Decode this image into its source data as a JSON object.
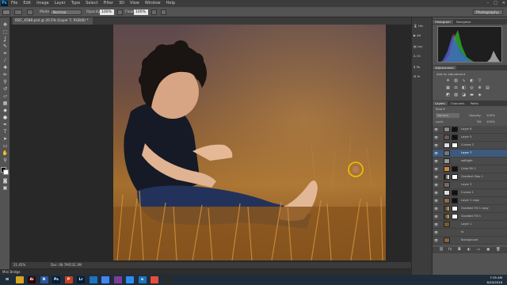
{
  "app": {
    "logo": "Ps"
  },
  "menu": [
    "File",
    "Edit",
    "Image",
    "Layer",
    "Type",
    "Select",
    "Filter",
    "3D",
    "View",
    "Window",
    "Help"
  ],
  "window_controls": [
    "–",
    "□",
    "✕"
  ],
  "options": {
    "mode_label": "Mode:",
    "mode_value": "Normal",
    "opacity_label": "Opacity:",
    "opacity_value": "100%",
    "flow_label": "Flow:",
    "flow_value": "100%",
    "workspace": "Photography"
  },
  "document": {
    "tab_title": "DSC_4588.psd @ 20.5% (Layer 7, RGB/8) *",
    "zoom": "21.45%",
    "doc_info": "Doc: 68.7M/532.3M"
  },
  "minibridge": "Mini Bridge",
  "dock_labels": [
    "His",
    "Ad",
    "Lay",
    "Ch",
    "Pa",
    "Pr"
  ],
  "panels": {
    "histogram_tabs": [
      "Histogram",
      "Navigator"
    ],
    "adjustments_tab": "Adjustments",
    "adjustments_hint": "Add an adjustment",
    "layers_tabs": [
      "Layers",
      "Channels",
      "Paths"
    ],
    "kind_label": "Kind",
    "blend_mode": "Normal",
    "opacity_label": "Opacity:",
    "opacity_value": "100%",
    "lock_label": "Lock:",
    "fill_label": "Fill:",
    "fill_value": "100%"
  },
  "layers": [
    {
      "name": "Layer 6"
    },
    {
      "name": "Layer 5"
    },
    {
      "name": "Curves 2"
    },
    {
      "name": "Layer 7"
    },
    {
      "name": "softlight"
    },
    {
      "name": "Color Fill 1"
    },
    {
      "name": "Gradient Map 1"
    },
    {
      "name": "Layer 3"
    },
    {
      "name": "Curves 1"
    },
    {
      "name": "Layer 2 copy"
    },
    {
      "name": "Gradient Fill 1 copy"
    },
    {
      "name": "Gradient Fill 1"
    },
    {
      "name": "Layer 1"
    },
    {
      "name": "fx"
    },
    {
      "name": "Background"
    }
  ],
  "taskbar_icons": [
    {
      "label": "⊞",
      "color": "#1f2d3b"
    },
    {
      "label": "",
      "color": "#d9a520"
    },
    {
      "label": "Ai",
      "color": "#330000"
    },
    {
      "label": "N",
      "color": "#2b579a"
    },
    {
      "label": "Ps",
      "color": "#001e36"
    },
    {
      "label": "P",
      "color": "#c43e1c"
    },
    {
      "label": "Lr",
      "color": "#001e36"
    },
    {
      "label": "",
      "color": "#1e73be"
    },
    {
      "label": "",
      "color": "#4285f4"
    },
    {
      "label": "",
      "color": "#7d3c98"
    },
    {
      "label": "",
      "color": "#2d8cf0"
    },
    {
      "label": "e",
      "color": "#1e73be"
    },
    {
      "label": "",
      "color": "#e84c3d"
    },
    {
      "label": "",
      "color": "#2b2b2b"
    }
  ],
  "clock": {
    "time": "7:35 AM",
    "date": "6/25/2018"
  },
  "colors": {
    "accent": "#31a8ff",
    "selected_layer": "#3d5a7e",
    "cursor_ring": "#f2c200"
  }
}
